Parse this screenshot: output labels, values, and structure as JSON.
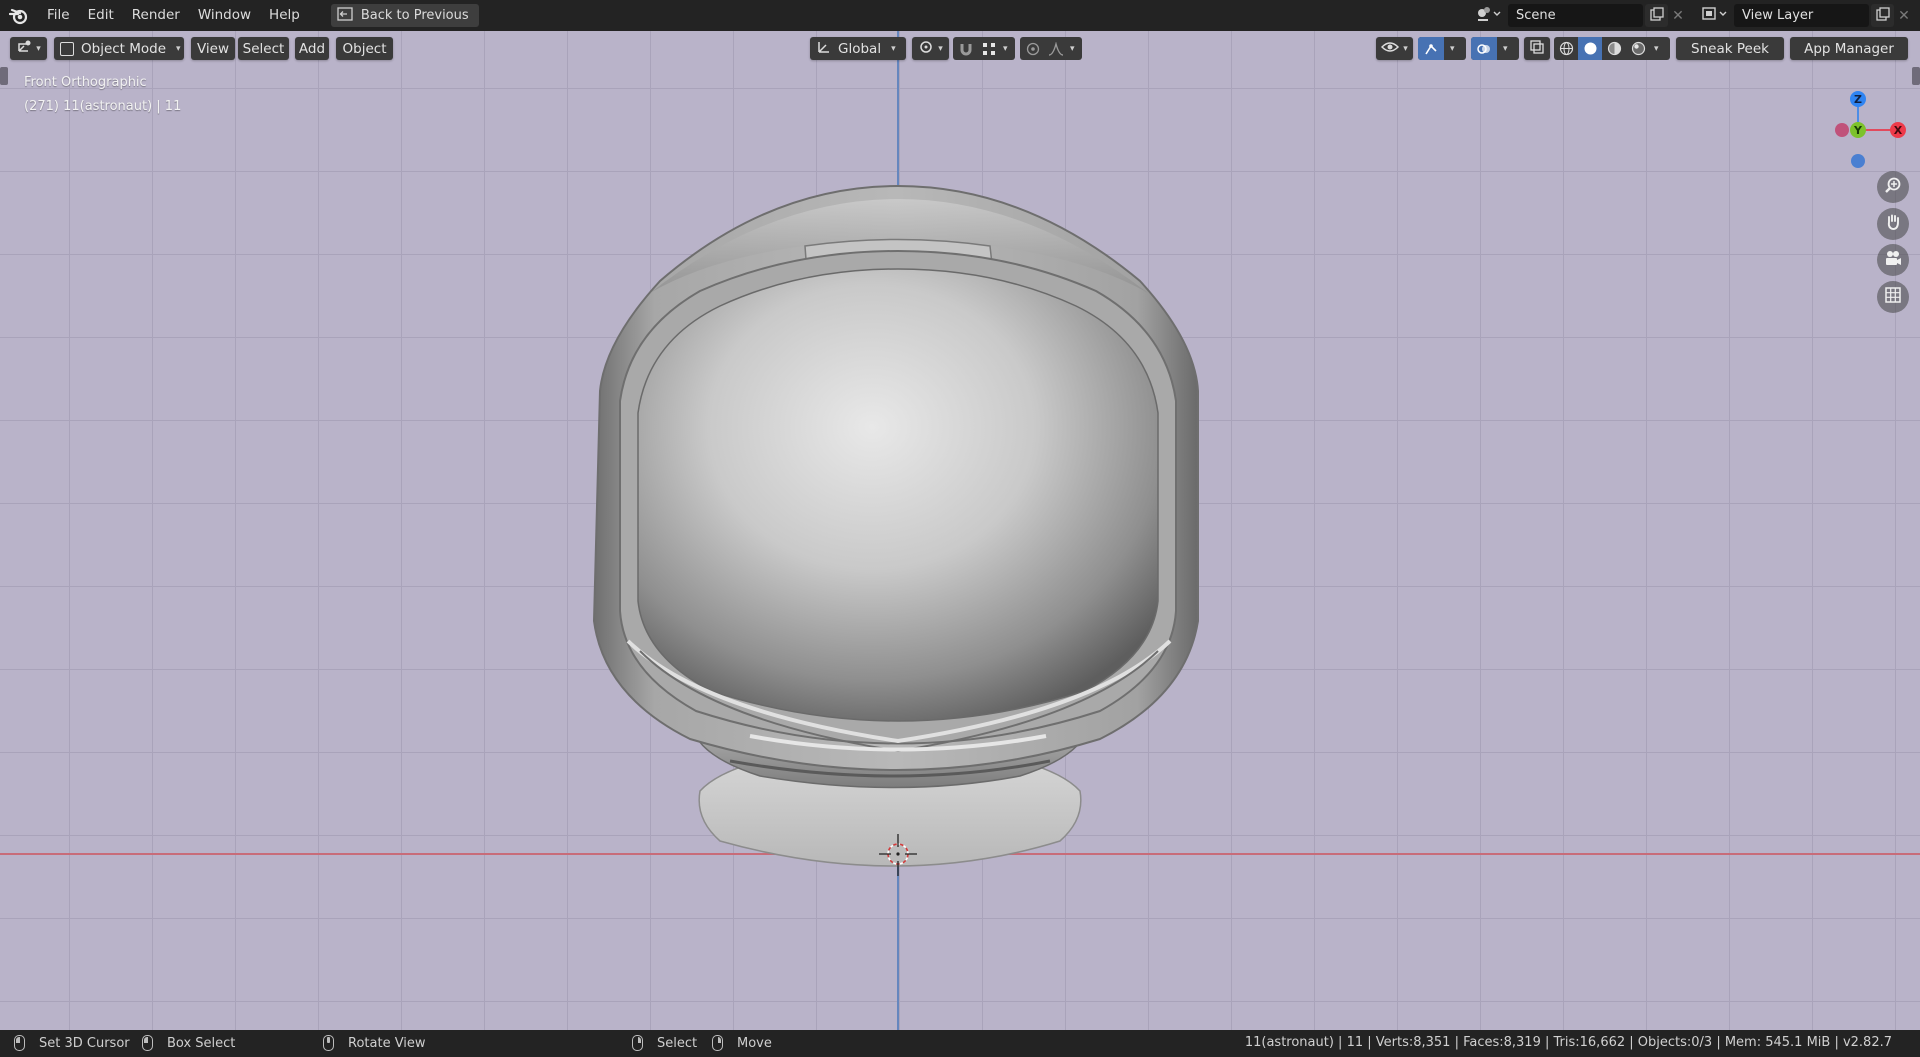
{
  "menubar": {
    "items": [
      "File",
      "Edit",
      "Render",
      "Window",
      "Help"
    ],
    "back_button": "Back to Previous",
    "scene_label": "Scene",
    "view_layer_label": "View Layer"
  },
  "viewport_header": {
    "mode": "Object Mode",
    "menus": [
      "View",
      "Select",
      "Add",
      "Object"
    ],
    "transform_orientation": "Global",
    "sneak_peek": "Sneak Peek",
    "app_manager": "App Manager"
  },
  "viewport": {
    "view_name": "Front Orthographic",
    "object_info": "(271) 11(astronaut) | 11",
    "gizmo": {
      "z": "Z",
      "y": "Y",
      "x": "X"
    },
    "colors": {
      "x_axis": "#c86c79",
      "z_axis": "#6586be",
      "background": "#b9b3c9"
    }
  },
  "statusbar": {
    "set_cursor": "Set 3D Cursor",
    "box_select": "Box Select",
    "rotate_view": "Rotate View",
    "select": "Select",
    "move": "Move",
    "stats": "11(astronaut) | 11 | Verts:8,351 | Faces:8,319 | Tris:16,662 | Objects:0/3 | Mem: 545.1 MiB | v2.82.7"
  }
}
